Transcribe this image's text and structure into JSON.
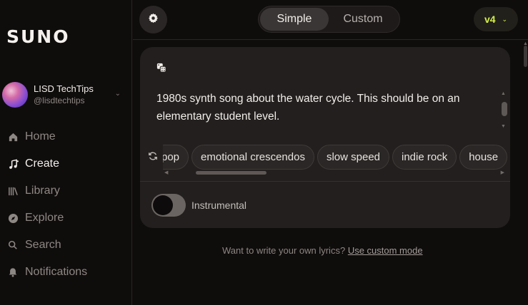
{
  "app": {
    "logo": "SUNO"
  },
  "profile": {
    "name": "LISD TechTips",
    "handle": "@lisdtechtips"
  },
  "nav": {
    "items": [
      {
        "label": "Home",
        "icon": "home-icon"
      },
      {
        "label": "Create",
        "icon": "music-note-icon",
        "active": true
      },
      {
        "label": "Library",
        "icon": "library-icon"
      },
      {
        "label": "Explore",
        "icon": "compass-icon"
      },
      {
        "label": "Search",
        "icon": "search-icon"
      },
      {
        "label": "Notifications",
        "icon": "bell-icon"
      }
    ]
  },
  "topbar": {
    "mode": {
      "simple_label": "Simple",
      "custom_label": "Custom",
      "selected": "Simple"
    },
    "version_label": "v4"
  },
  "card": {
    "prompt": "1980s synth song about the water cycle.  This should be on an elementary student level.",
    "tags": [
      "pop",
      "emotional crescendos",
      "slow speed",
      "indie rock",
      "house"
    ],
    "instrumental_label": "Instrumental",
    "instrumental_on": false
  },
  "hint": {
    "text": "Want to write your own lyrics?",
    "link": "Use custom mode"
  },
  "colors": {
    "accent": "#d4f04a",
    "background": "#0f0c0c",
    "card": "#221f1e"
  }
}
